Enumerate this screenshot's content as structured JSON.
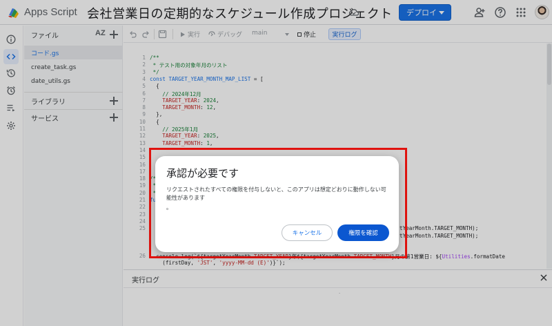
{
  "header": {
    "app_name": "Apps Script",
    "project_title": "会社営業日の定期的なスケジュール作成プロジェクト",
    "deploy_label": "デプロイ",
    "brand_color": "#1a73e8",
    "icons": [
      "cloud-icon",
      "add-person-icon",
      "help-icon",
      "apps-grid-icon"
    ]
  },
  "rail": {
    "items": [
      "info-icon",
      "code-icon",
      "history-icon",
      "alarm-icon",
      "executions-icon",
      "settings-icon"
    ]
  },
  "files": {
    "title": "ファイル",
    "sort_label": "AZ",
    "items": [
      {
        "name": "コード.gs",
        "selected": true
      },
      {
        "name": "create_task.gs",
        "selected": false
      },
      {
        "name": "date_utils.gs",
        "selected": false
      }
    ],
    "libraries_label": "ライブラリ",
    "services_label": "サービス"
  },
  "toolbar": {
    "run_label": "実行",
    "debug_label": "デバッグ",
    "function_name": "main",
    "stop_label": "停止",
    "log_label": "実行ログ"
  },
  "editor": {
    "line_numbers": [
      "1",
      "2",
      "3",
      "4",
      "5",
      "6",
      "7",
      "8",
      "9",
      "10",
      "11",
      "12",
      "13",
      "14",
      "15",
      "16",
      "17",
      "18",
      "19",
      "20",
      "21",
      "22",
      "23",
      "24",
      "25",
      "26"
    ],
    "lines": {
      "l1": "/**",
      "l2": " * テスト用の対象年月のリスト",
      "l3": " */",
      "l4a": "const ",
      "l4b": "TARGET_YEAR_MONTH_MAP_LIST",
      "l4c": " = [",
      "l5": "  {",
      "l6": "    // 2024年12月",
      "l7a": "    TARGET_YEAR",
      "l7b": ": ",
      "l7c": "2024",
      "l7d": ",",
      "l8a": "    TARGET_MONTH",
      "l8b": ": ",
      "l8c": "12",
      "l8d": ",",
      "l9": "  },",
      "l10": "  {",
      "l11": "    // 2025年1月",
      "l12a": "    TARGET_YEAR",
      "l12b": ": ",
      "l12c": "2025",
      "l12d": ",",
      "l13a": "    TARGET_MONTH",
      "l13b": ": ",
      "l13c": "1",
      "l13d": ",",
      "l16": "/*",
      "l17": " *",
      "l18": " *",
      "l19": "fu",
      "l23": "tYearMonth.TARGET_MONTH);",
      "l24": "tYearMonth.TARGET_MONTH);",
      "l26a": "  console.log(`${targetYearMonth.",
      "l26b": "TARGET_YEAR",
      "l26c": "}年${targetYearMonth.",
      "l26d": "TARGET_MONTH",
      "l26e": "}月の第1営業日: ${",
      "l26f": "Utilities",
      "l26g": ".formatDate",
      "l26h": "    (firstDay, ",
      "l26i": "'JST'",
      "l26j": ", ",
      "l26k": "'yyyy-MM-dd (E)'",
      "l26l": ")}`);"
    }
  },
  "log_panel": {
    "title": "実行ログ",
    "dash": "-"
  },
  "dialog": {
    "title": "承認が必要です",
    "message": "リクエストされたすべての権限を付与しないと、このアプリは想定どおりに動作しない可能性があります",
    "message_tail": "。",
    "cancel_label": "キャンセル",
    "confirm_label": "権限を確認",
    "confirm_color": "#0b57d0",
    "highlight_color": "#e0130f"
  }
}
